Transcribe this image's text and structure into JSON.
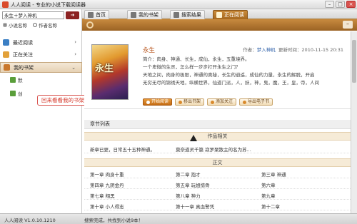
{
  "window": {
    "title": "人人阅读 - 专业的小说下载阅读器"
  },
  "sidebar": {
    "search_value": "永生＋梦入神机",
    "radio_novel": "小说名称",
    "radio_author": "作者名称",
    "items": [
      {
        "label": "最近阅读",
        "icon": "recent-icon",
        "color": "#3b7fc4"
      },
      {
        "label": "正在关注",
        "icon": "follow-icon",
        "color": "#e2a13a"
      },
      {
        "label": "我的书架",
        "icon": "bookshelf-icon",
        "color": "#c9772b"
      }
    ],
    "sub_items": [
      "默",
      "创"
    ],
    "tooltip": "回来看看我的书架！"
  },
  "tabs": [
    {
      "label": "首页",
      "icon": "home-icon"
    },
    {
      "label": "我的书架",
      "icon": "shelf-icon"
    },
    {
      "label": "搜索结果",
      "icon": "search-icon"
    },
    {
      "label": "正在阅读",
      "icon": "reading-icon"
    }
  ],
  "book": {
    "cover_text": "永生",
    "title": "永生",
    "author_label": "作者：",
    "author": "梦入神机",
    "update_label": "更新时间：",
    "update_time": "2010-11-15 20:31",
    "desc_lines": [
      "简介：肉身、神通、长生，成仙，永生，五重境界。",
      "一个卑微的生灵，怎么样一步步打开永生之门？",
      "天地之间，肉身的极限，神通的奥秘，长生的逍遥，成仙的力量，永生的解脱，开启",
      "无穷无尽的锦绣天地，纵横世界，仙道门派，人，妖，神，鬼，魔，王，皇，帝，人间"
    ],
    "actions": [
      "开始阅读",
      "移出书架",
      "添加关注",
      "导出电子书"
    ]
  },
  "chapters": {
    "section_title": "章节列表",
    "related_header": "作品相关",
    "related": [
      "新章已更，日常五十五种神通。",
      "莫奈道灵千篇 寂罗聚散主的名为苏..."
    ],
    "main_header": "正文",
    "rows": [
      [
        "第一章 肉身十重",
        "第二章 抱才",
        "第三章 神通"
      ],
      [
        "第四章 九阴金丹",
        "第五章 玩姐惊骨",
        "第六章 "
      ],
      [
        "第七章 翔黑",
        "第八章 神力",
        "第九章 "
      ],
      [
        "第十章 小人得志",
        "第十一章 真血警凭",
        "第十二章 "
      ]
    ]
  },
  "status": {
    "version": "人人阅读 V1.0.10.1210",
    "message": "搜索完成，共找到小说9本！"
  }
}
